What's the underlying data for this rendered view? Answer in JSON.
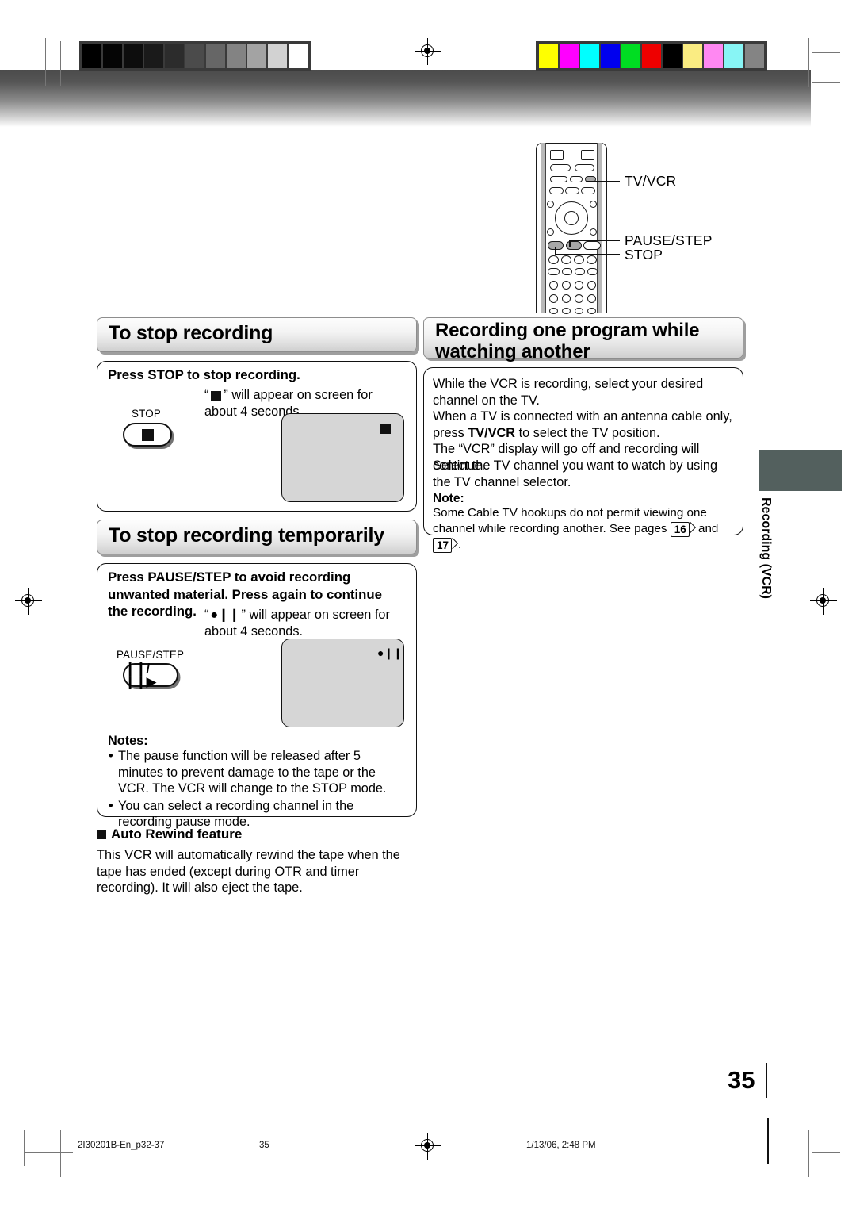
{
  "document": {
    "page_number": "35",
    "side_tab_label": "Recording (VCR)",
    "footer": {
      "job_code": "2I30201B-En_p32-37",
      "page": "35",
      "timestamp": "1/13/06, 2:48 PM"
    }
  },
  "remote": {
    "callouts": [
      {
        "label": "TV/VCR"
      },
      {
        "label": "PAUSE/STEP"
      },
      {
        "label": "STOP"
      }
    ]
  },
  "sections": {
    "stop_recording": {
      "heading": "To stop recording",
      "lead": "Press STOP to stop recording.",
      "description_pre": "“",
      "description_post": "” will appear on screen for about 4 seconds.",
      "button_label": "STOP",
      "button_glyph": "■",
      "osd_glyph": "■"
    },
    "stop_temporarily": {
      "heading": "To stop recording temporarily",
      "lead": "Press PAUSE/STEP to avoid recording unwanted material. Press again to continue the recording.",
      "description_pre": "“",
      "description_post": "” will appear on screen for about 4 seconds.",
      "button_label": "PAUSE/STEP",
      "button_glyph": "❙❙/❙❙▶",
      "osd_glyph": "●❙❙",
      "notes_title": "Notes:",
      "notes": [
        "The pause function will be released after 5 minutes to prevent damage to the tape or the VCR. The VCR will change to the STOP mode.",
        "You can select a recording channel in the recording pause mode."
      ]
    },
    "auto_rewind": {
      "heading": "Auto Rewind feature",
      "body": "This VCR will automatically rewind the tape when the tape has ended (except during OTR and timer recording). It will also eject the tape."
    },
    "record_while_watching": {
      "heading": "Recording one program while watching another",
      "paragraphs": [
        "While the VCR is recording, select your desired channel on the TV.",
        "When a TV is connected with an antenna cable only, press TV/VCR to select the TV position.",
        "The “VCR” display will go off and recording will continue.",
        "Select the TV channel you want to watch by using the TV channel selector."
      ],
      "bold_term": "TV/VCR",
      "note_title": "Note:",
      "note_text_a": "Some Cable TV hookups do not permit viewing one channel while recording another. See pages",
      "note_ref_1": "16",
      "note_conj": "and",
      "note_ref_2": "17",
      "note_text_b": "."
    }
  },
  "print_marks": {
    "grayscale_steps": [
      "#000000",
      "#050505",
      "#0d0d0d",
      "#1a1a1a",
      "#2c2c2c",
      "#4b4b4b",
      "#666666",
      "#838383",
      "#a3a3a3",
      "#d2d2d2",
      "#ffffff"
    ],
    "color_bars": [
      "#ffff00",
      "#ff00ff",
      "#00ffff",
      "#0000ee",
      "#00dd22",
      "#ee0000",
      "#000000",
      "#faec82",
      "#ff88f2",
      "#88f5f5",
      "#848484"
    ]
  }
}
